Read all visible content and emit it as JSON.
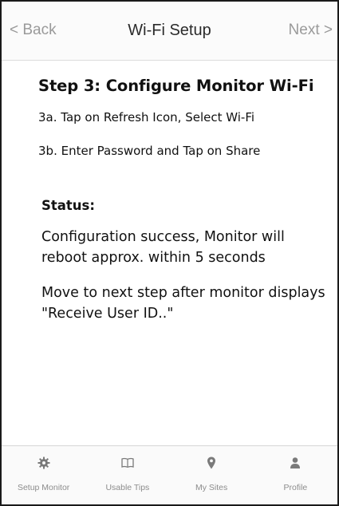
{
  "nav": {
    "back_label": "< Back",
    "title": "Wi-Fi Setup",
    "next_label": "Next >"
  },
  "content": {
    "step_title": "Step 3: Configure Monitor Wi-Fi",
    "instruction_a": "3a. Tap on Refresh Icon, Select Wi-Fi",
    "instruction_b": "3b. Enter Password and Tap on Share",
    "status_label": "Status:",
    "status_text": "Configuration success, Monitor will reboot approx. within 5 seconds",
    "hint_text": "Move to next step after monitor displays \"Receive User ID..\""
  },
  "tabs": [
    {
      "label": "Setup Monitor",
      "icon": "gear-icon"
    },
    {
      "label": "Usable Tips",
      "icon": "book-icon"
    },
    {
      "label": "My Sites",
      "icon": "map-pin-icon"
    },
    {
      "label": "Profile",
      "icon": "person-icon"
    }
  ],
  "colors": {
    "nav_inactive": "#9a9a9a",
    "title_text": "#2b2b2b",
    "tab_text": "#8c8c8c",
    "tab_icon": "#7a7a7a"
  }
}
